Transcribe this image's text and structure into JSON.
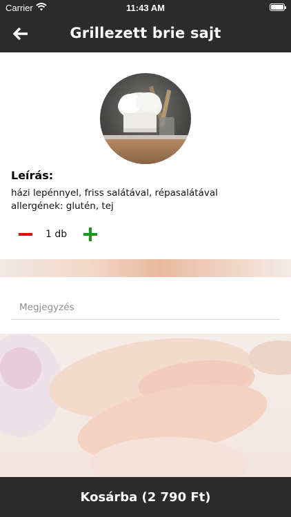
{
  "status_bar": {
    "carrier": "Carrier",
    "time": "11:43 AM",
    "icons": [
      "wifi-icon",
      "battery-icon"
    ]
  },
  "nav": {
    "title": "Grillezett brie sajt",
    "back_icon": "arrow-left-icon"
  },
  "product": {
    "image": "chef-hat-kitchen-photo",
    "description_heading": "Leírás:",
    "description_lines": [
      "házi lepénnyel, friss salátával, répasalátával",
      "allergének: glutén, tej"
    ]
  },
  "quantity": {
    "value": "1 db",
    "minus_icon": "minus-icon",
    "plus_icon": "plus-icon"
  },
  "note": {
    "placeholder": "Megjegyzés",
    "value": ""
  },
  "cart_button": {
    "label": "Kosárba (2 790 Ft)"
  },
  "colors": {
    "bar_background": "#2b2b2b",
    "minus": "#e10e0e",
    "plus": "#1a9a1a",
    "text": "#111111"
  }
}
